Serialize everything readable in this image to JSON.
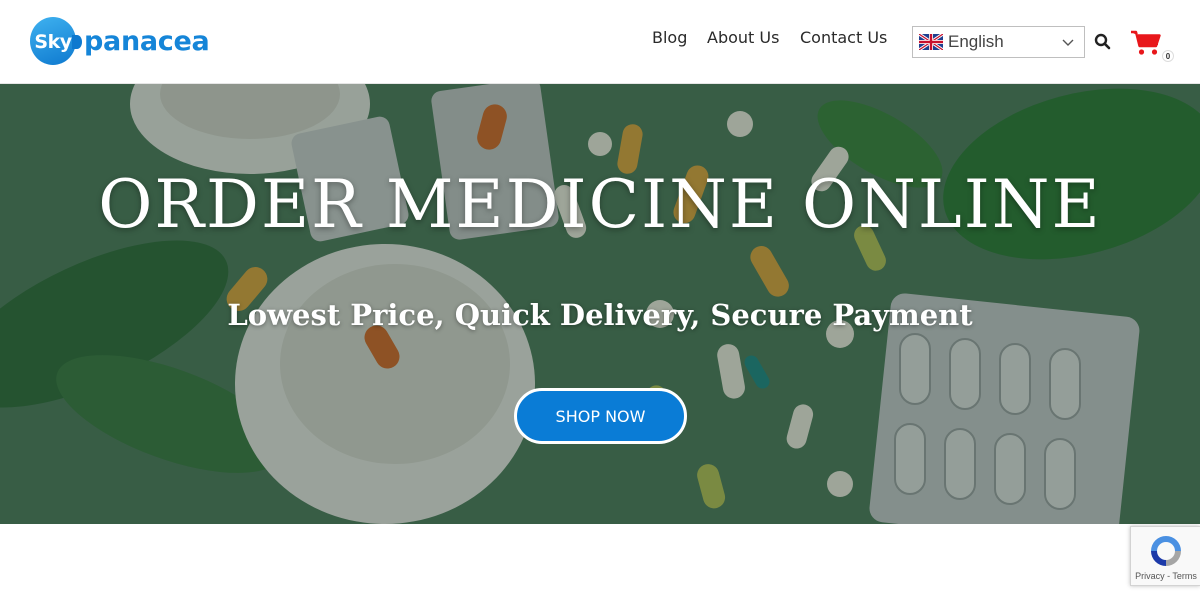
{
  "brand": {
    "logo_badge": "Sky",
    "logo_text": "panacea"
  },
  "nav": {
    "items": [
      {
        "label": "Blog"
      },
      {
        "label": "About Us"
      },
      {
        "label": "Contact Us"
      }
    ]
  },
  "language": {
    "selected": "English",
    "flag_icon": "uk-flag-icon"
  },
  "cart": {
    "count": "0",
    "icon": "cart-icon",
    "color": "#e8171b"
  },
  "search": {
    "icon": "search-icon"
  },
  "hero": {
    "title": "ORDER MEDICINE ONLINE",
    "subtitle": "Lowest Price, Quick Delivery, Secure Payment",
    "cta_label": "SHOP NOW",
    "cta_color": "#0a7cd6"
  },
  "recaptcha": {
    "links": "Privacy - Terms"
  },
  "colors": {
    "accent": "#1585d8",
    "hero_bg": "#4d7a5d"
  }
}
